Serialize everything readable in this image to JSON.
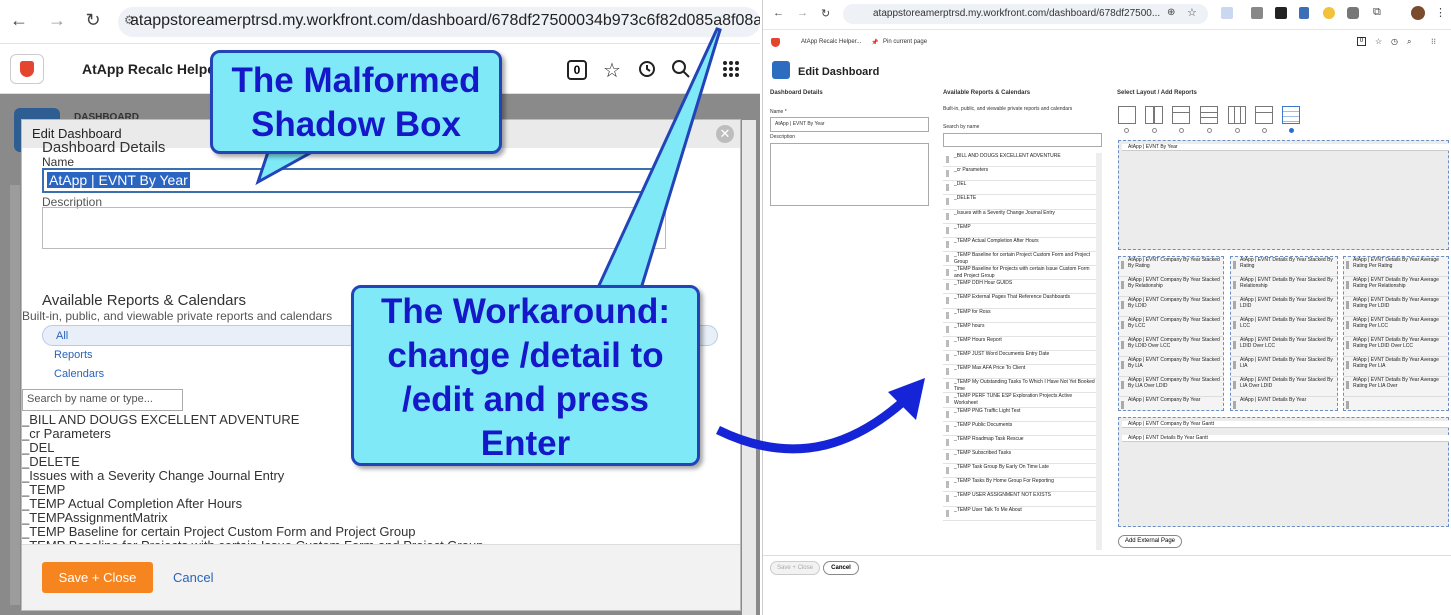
{
  "left": {
    "browser": {
      "url": "atappstoreamerptrsd.my.workfront.com/dashboard/678df27500034b973c6f82d085a8f08a/detail"
    },
    "app": {
      "title": "AtApp Recalc Helper...",
      "badge_count": "0"
    },
    "background": {
      "crumb": "DASHBOARD"
    },
    "modal": {
      "title": "Edit Dashboard",
      "section_details": "Dashboard Details",
      "name_label": "Name",
      "name_value": "AtApp | EVNT By Year",
      "description_label": "Description",
      "section_available": "Available Reports & Calendars",
      "available_subtitle": "Built-in, public, and viewable private reports and calendars",
      "filters": [
        "All",
        "Reports",
        "Calendars"
      ],
      "search_placeholder": "Search by name or type...",
      "reports": [
        "_BILL AND DOUGS EXCELLENT ADVENTURE",
        "_cr Parameters",
        "_DEL",
        "_DELETE",
        "_Issues with a Severity Change Journal Entry",
        "_TEMP",
        "_TEMP Actual Completion After Hours",
        "_TEMPAssignmentMatrix",
        "_TEMP Baseline for certain Project Custom Form and Project Group",
        "_TEMP Baseline for Projects with certain Issue Custom Form and Project Group"
      ],
      "save_label": "Save + Close",
      "cancel_label": "Cancel"
    }
  },
  "callouts": {
    "malformed": "The Malformed Shadow Box",
    "workaround": "The Workaround: change /detail to /edit and press Enter"
  },
  "right": {
    "browser": {
      "url": "atappstoreamerptrsd.my.workfront.com/dashboard/678df27500..."
    },
    "bookmarks": {
      "item1": "AtApp Recalc Helper...",
      "item2": "Pin current page"
    },
    "badge_count": "0",
    "title": "Edit Dashboard",
    "details": {
      "heading": "Dashboard Details",
      "name_label": "Name *",
      "name_value": "AtApp | EVNT By Year",
      "description_label": "Description"
    },
    "available": {
      "heading": "Available Reports & Calendars",
      "subtitle": "Built-in, public, and viewable private reports and calendars",
      "search_label": "Search by name",
      "items": [
        "_BILL AND DOUGS EXCELLENT ADVENTURE",
        "_cr Parameters",
        "_DEL",
        "_DELETE",
        "_Issues with a Severity Change Journal Entry",
        "_TEMP",
        "_TEMP Actual Completion After Hours",
        "_TEMP Baseline for certain Project Custom Form and Project Group",
        "_TEMP Baseline for Projects with certain Issue Custom Form and Project Group",
        "_TEMP DDH Hour GUIDS",
        "_TEMP External Pages That Reference Dashboards",
        "_TEMP for Ross",
        "_TEMP hours",
        "_TEMP Hours Report",
        "_TEMP JUST Word Documents Entry Date",
        "_TEMP Max AFA Price To Client",
        "_TEMP My Outstanding Tasks To Which I Have Not Yet Booked Time",
        "_TEMP PERF TUNE ESP Exploration Projects Active Worksheet",
        "_TEMP PNG Traffic Light Test",
        "_TEMP Public Documents",
        "_TEMP Roadmap Task Rescue",
        "_TEMP Subscribed Tasks",
        "_TEMP Task Group By Early On Time Late",
        "_TEMP Tasks By Home Group For Reporting",
        "_TEMP USER ASSIGNMENT NOT EXISTS",
        "_TEMP User Talk To Me About"
      ]
    },
    "layout": {
      "heading": "Select Layout / Add Reports",
      "top_zone_item": "AtApp | EVNT By Year",
      "col1": [
        "AtApp | EVNT Company By Year Stacked By Rating",
        "AtApp | EVNT Company By Year Stacked By Relationship",
        "AtApp | EVNT Company By Year Stacked By LDID",
        "AtApp | EVNT Company By Year Stacked By LCC",
        "AtApp | EVNT Company By Year Stacked By LDID Over LCC",
        "AtApp | EVNT Company By Year Stacked By LIA",
        "AtApp | EVNT Company By Year Stacked By LIA Over LDID",
        "AtApp | EVNT Company By Year"
      ],
      "col2": [
        "AtApp | EVNT Details By Year Stacked By Rating",
        "AtApp | EVNT Details By Year Stacked By Relationship",
        "AtApp | EVNT Details By Year Stacked By LDID",
        "AtApp | EVNT Details By Year Stacked By LCC",
        "AtApp | EVNT Details By Year Stacked By LDID Over LCC",
        "AtApp | EVNT Details By Year Stacked By LIA",
        "AtApp | EVNT Details By Year Stacked By LIA Over LDID",
        "AtApp | EVNT Details By Year"
      ],
      "col3": [
        "AtApp | EVNT Details By Year Average Rating Per Rating",
        "AtApp | EVNT Details By Year Average Rating Per Relationship",
        "AtApp | EVNT Details By Year Average Rating Per LDID",
        "AtApp | EVNT Details By Year Average Rating Per LCC",
        "AtApp | EVNT Details By Year Average Rating Per LDID Over LCC",
        "AtApp | EVNT Details By Year Average Rating Per LIA",
        "AtApp | EVNT Details By Year Average Rating Per LIA Over",
        ""
      ],
      "bottom_items": [
        "AtApp | EVNT Company By Year Gantt",
        "AtApp | EVNT Details By Year Gantt"
      ],
      "add_external": "Add External Page"
    },
    "save_label": "Save + Close",
    "cancel_label": "Cancel"
  }
}
